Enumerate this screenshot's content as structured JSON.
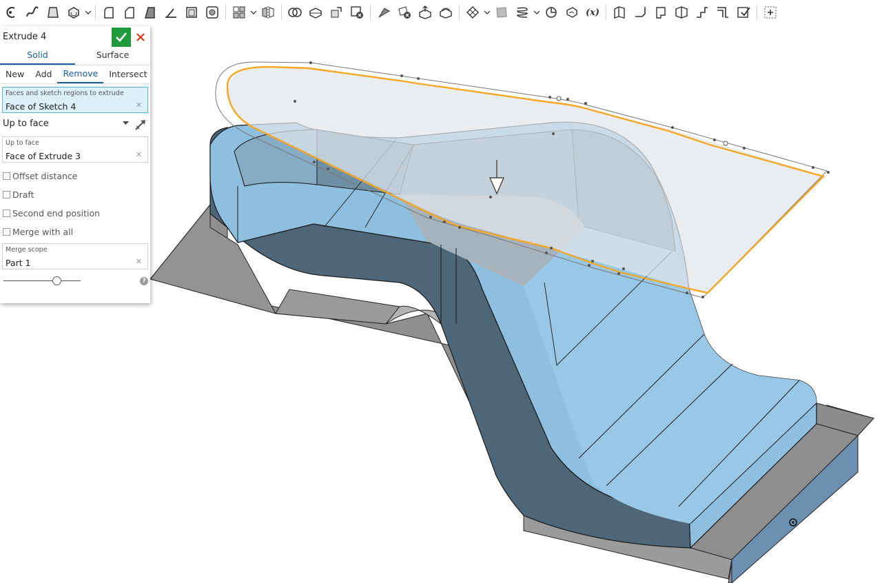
{
  "toolbar": {
    "icons": [
      "sketch-icon",
      "curve-icon",
      "extrude-icon",
      "revolve-icon",
      "sweep-icon",
      "loft-icon",
      "fillet-icon",
      "chamfer-icon",
      "draft-icon",
      "rib-icon",
      "shell-icon",
      "hole-icon",
      "pattern-icon",
      "mirror-icon",
      "boolean-icon",
      "split-icon",
      "transform-icon",
      "delete-part-icon",
      "modify-fillet-icon",
      "delete-face-icon",
      "move-face-icon",
      "replace-face-icon",
      "mesh-icon",
      "plane-icon",
      "helix-icon",
      "mate-connector-icon",
      "wrap-icon",
      "variable-icon",
      "sheet-metal-icon",
      "flange-icon",
      "hem-icon",
      "tab-icon",
      "joint-icon",
      "corner-icon",
      "bend-relief-icon",
      "finish-icon",
      "add-custom-feature-icon"
    ],
    "variable_label": "(x)"
  },
  "dialog": {
    "title": "Extrude 4",
    "type_tabs": [
      "Solid",
      "Surface"
    ],
    "active_type": "Solid",
    "operation_tabs": [
      "New",
      "Add",
      "Remove",
      "Intersect"
    ],
    "active_operation": "Remove",
    "faces_field": {
      "label": "Faces and sketch regions to extrude",
      "value": "Face of Sketch 4"
    },
    "end_type": "Up to face",
    "up_to_face_field": {
      "label": "Up to face",
      "value": "Face of Extrude 3"
    },
    "options": [
      "Offset distance",
      "Draft",
      "Second end position",
      "Merge with all"
    ],
    "merge_scope_field": {
      "label": "Merge scope",
      "value": "Part 1"
    },
    "help_label": "?",
    "slider_level": 0.69
  },
  "colors": {
    "accent": "#1b5ea0",
    "ok": "#1f9b3b",
    "cancel": "#d9381e",
    "selection_highlight": "#dbf0f9",
    "sketch_orange": "#f5a623",
    "part_blue": "#8ebfdf",
    "part_dark": "#4d6678",
    "base_gray": "#8f8f8f"
  }
}
